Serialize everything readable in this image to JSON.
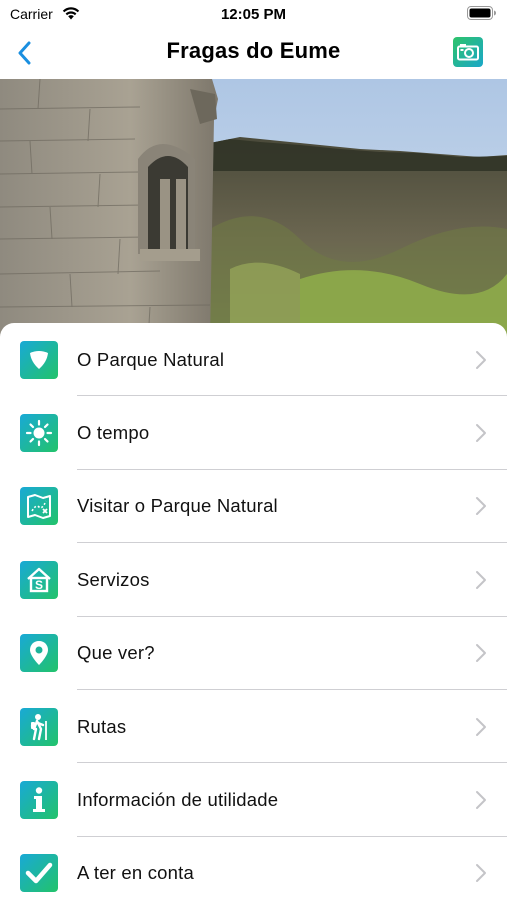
{
  "status_bar": {
    "carrier": "Carrier",
    "time": "12:05 PM",
    "wifi_icon": "wifi-icon",
    "battery_icon": "battery-icon"
  },
  "nav": {
    "title": "Fragas do Eume",
    "back_icon": "chevron-left-icon",
    "camera_icon": "camera-icon"
  },
  "hero": {
    "description_icon": "landscape-photo"
  },
  "menu": {
    "items": [
      {
        "label": "O Parque Natural",
        "icon": "shield-icon"
      },
      {
        "label": "O tempo",
        "icon": "sun-icon"
      },
      {
        "label": "Visitar o Parque Natural",
        "icon": "map-icon"
      },
      {
        "label": "Servizos",
        "icon": "house-s-icon"
      },
      {
        "label": "Que ver?",
        "icon": "location-pin-icon"
      },
      {
        "label": "Rutas",
        "icon": "hiker-icon"
      },
      {
        "label": "Información de utilidade",
        "icon": "info-icon"
      },
      {
        "label": "A ter en conta",
        "icon": "checkmark-icon"
      }
    ]
  },
  "colors": {
    "accent_blue": "#1a8fe0",
    "icon_gradient_start": "#19a9d6",
    "icon_gradient_end": "#22c36a",
    "separator": "#cfcfd3"
  }
}
